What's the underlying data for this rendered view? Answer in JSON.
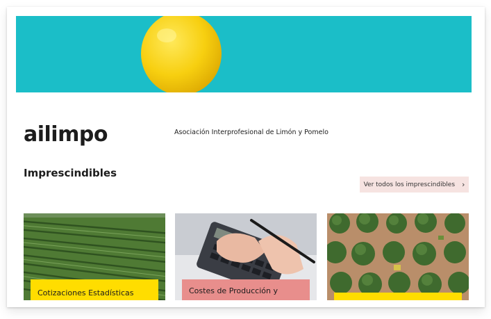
{
  "hero": {
    "image": "lemon-on-turquoise",
    "background": "#1bbec8"
  },
  "brand": {
    "logo_text": "ailimpo",
    "tagline": "Asociación Interprofesional de Limón y Pomelo"
  },
  "section": {
    "title": "Imprescindibles",
    "see_all_label": "Ver todos los imprescindibles",
    "see_all_icon": "chevron-right-icon"
  },
  "tiles": [
    {
      "label": "Cotizaciones Estadísticas",
      "image": "citrus-orchard-rows",
      "label_color": "#ffdd00"
    },
    {
      "label": "Costes de Producción y",
      "image": "hand-with-calculator",
      "label_color": "#e88e8c"
    },
    {
      "label": "",
      "image": "aerial-citrus-trees",
      "label_color": "#ffdd00"
    }
  ]
}
